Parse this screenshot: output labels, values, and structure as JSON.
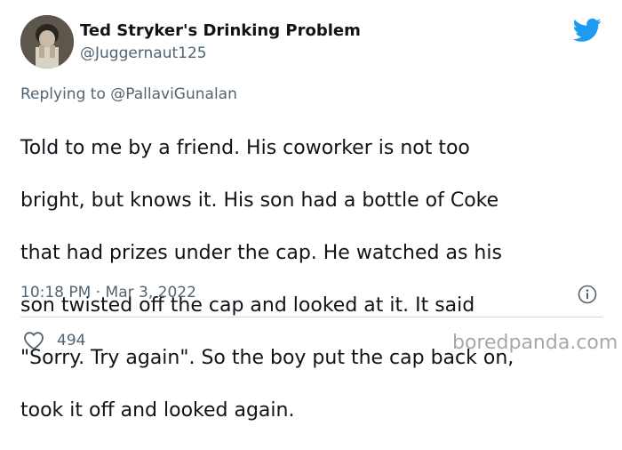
{
  "author": {
    "display_name": "Ted Stryker's Drinking Problem",
    "handle": "@Juggernaut125",
    "avatar": "profile-photo"
  },
  "reply": {
    "prefix": "Replying to",
    "mention": "@PallaviGunalan"
  },
  "tweet": {
    "lines": [
      "Told to me by a friend. His coworker is not too",
      "bright, but knows it. His son had a bottle of Coke",
      "that had prizes under the cap. He watched as his",
      "son twisted off the cap and looked at it. It said",
      "\"Sorry. Try again\". So the boy put the cap back on,",
      "took it off and looked again."
    ],
    "timestamp": "10:18 PM · Mar 3, 2022"
  },
  "actions": {
    "like_icon": "heart-icon",
    "like_count": "494",
    "info_icon": "info-icon"
  },
  "brand": {
    "platform_icon": "twitter-bird-icon",
    "twitter_blue": "#1d9bf0",
    "watermark": "boredpanda.com"
  }
}
